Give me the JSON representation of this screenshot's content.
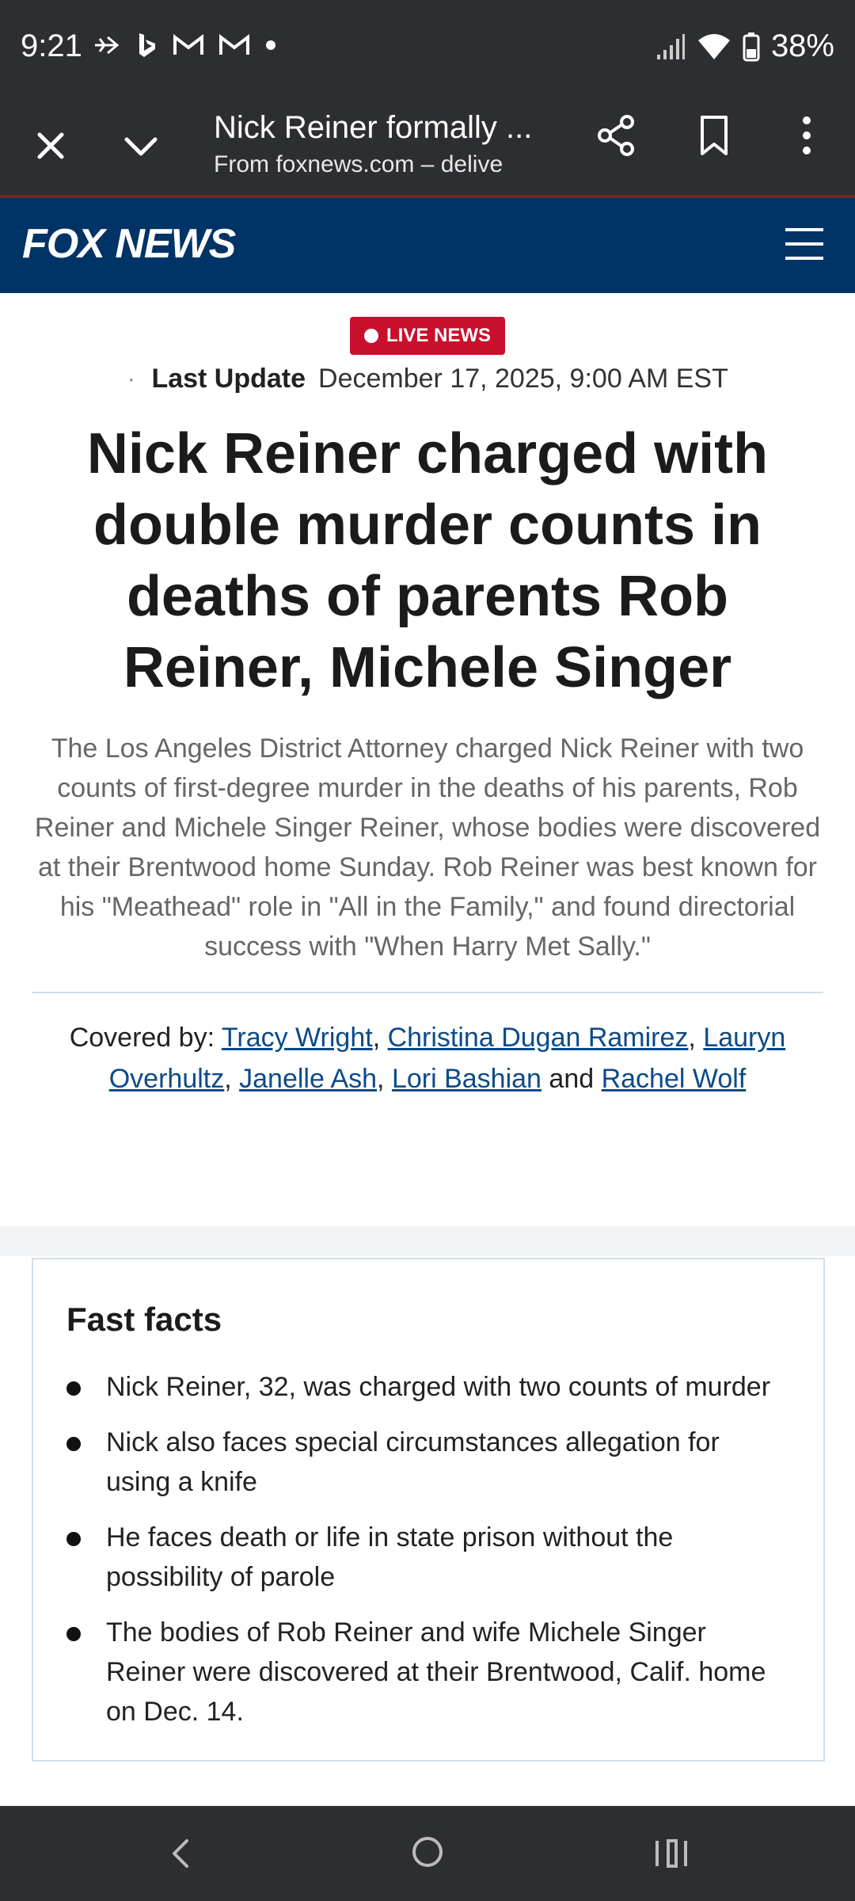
{
  "status_bar": {
    "time": "9:21",
    "battery": "38%",
    "left_icons": [
      "airplane-arrow-icon",
      "bing-icon",
      "gmail-icon",
      "gmail-icon",
      "dot-icon"
    ],
    "right_icons": [
      "signal-icon",
      "wifi-icon",
      "battery-icon"
    ]
  },
  "tab_bar": {
    "title": "Nick Reiner formally ...",
    "url": "From foxnews.com – delive"
  },
  "header": {
    "logo": "FOX NEWS"
  },
  "article": {
    "live_badge": "LIVE NEWS",
    "last_update_label": "Last Update",
    "last_update_value": "December 17, 2025, 9:00 AM EST",
    "headline": "Nick Reiner charged with double murder counts in deaths of parents Rob Reiner, Michele Singer",
    "dek": "The Los Angeles District Attorney charged Nick Reiner with two counts of first-degree murder in the deaths of his parents, Rob Reiner and Michele Singer Reiner, whose bodies were discovered at their Brentwood home Sunday. Rob Reiner was best known for his \"Meathead\" role in \"All in the Family,\" and found directorial success with \"When Harry Met Sally.\"",
    "byline": {
      "prefix": "Covered by:",
      "authors": [
        "Tracy Wright",
        "Christina Dugan Ramirez",
        "Lauryn Overhultz",
        "Janelle Ash",
        "Lori Bashian",
        "Rachel Wolf"
      ],
      "sep": ", ",
      "and": " and "
    }
  },
  "fast_facts": {
    "title": "Fast facts",
    "items": [
      "Nick Reiner, 32, was charged with two counts of murder",
      "Nick also faces special circumstances allegation for using a knife",
      "He faces death or life in state prison without the possibility of parole",
      "The bodies of Rob Reiner and wife Michele Singer Reiner were discovered at their Brentwood, Calif. home on Dec. 14."
    ]
  },
  "colors": {
    "fox_blue": "#003366",
    "live_red": "#c8102e",
    "link_blue": "#0b4a8a",
    "system_bar": "#2d2e31"
  }
}
